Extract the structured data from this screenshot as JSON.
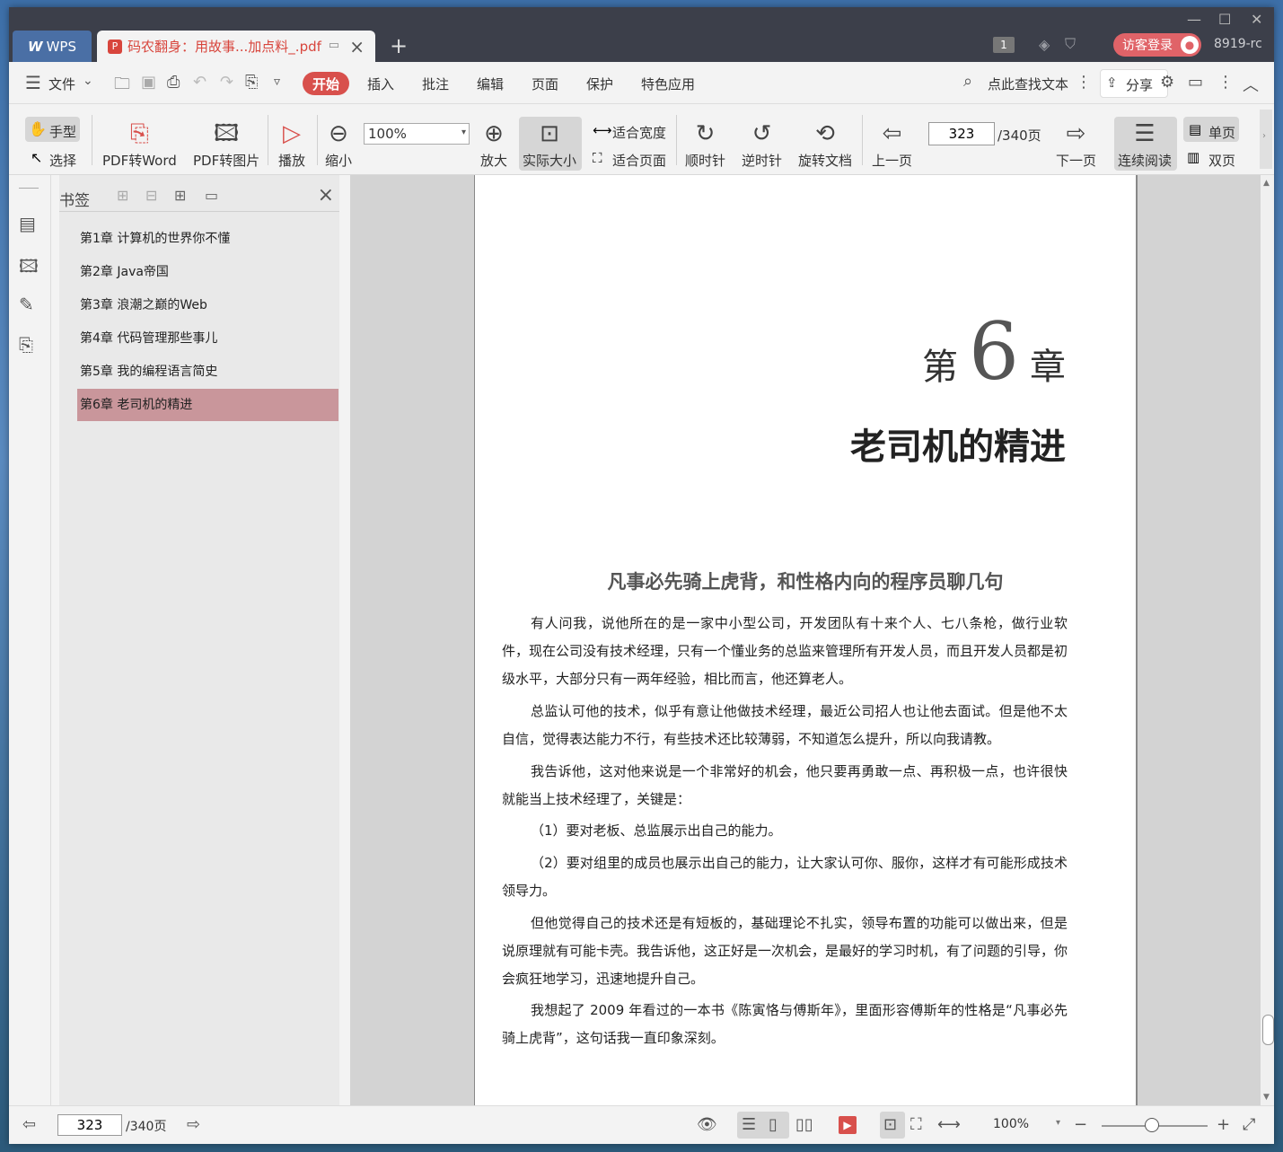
{
  "titlebar": {
    "wps_tab": "WPS",
    "doc_tab": "码农翻身：用故事...加点料_.pdf",
    "new_tab": "+",
    "badge": "1",
    "login": "访客登录",
    "user": "8919-rc"
  },
  "menu": {
    "file": "文件",
    "start": "开始",
    "insert": "插入",
    "annotate": "批注",
    "edit": "编辑",
    "page": "页面",
    "protect": "保护",
    "special": "特色应用",
    "search": "点此查找文本",
    "share": "分享"
  },
  "toolbar": {
    "hand": "手型",
    "select": "选择",
    "pdf_word": "PDF转Word",
    "pdf_img": "PDF转图片",
    "play": "播放",
    "zoom_out": "缩小",
    "zoom_value": "100%",
    "zoom_in": "放大",
    "actual": "实际大小",
    "fit_width": "适合宽度",
    "fit_page": "适合页面",
    "cw": "顺时针",
    "ccw": "逆时针",
    "rotate": "旋转文档",
    "prev": "上一页",
    "page_current": "323",
    "page_total": "/340页",
    "next": "下一页",
    "continuous": "连续阅读",
    "single": "单页",
    "double": "双页"
  },
  "bookmarks": {
    "title": "书签",
    "items": [
      "第1章 计算机的世界你不懂",
      "第2章 Java帝国",
      "第3章 浪潮之巅的Web",
      "第4章 代码管理那些事儿",
      "第5章 我的编程语言简史",
      "第6章 老司机的精进"
    ]
  },
  "page": {
    "chapter_pre": "第",
    "chapter_num": "6",
    "chapter_post": "章",
    "chapter_title": "老司机的精进",
    "section_title": "凡事必先骑上虎背，和性格内向的程序员聊几句",
    "paragraphs": [
      "有人问我，说他所在的是一家中小型公司，开发团队有十来个人、七八条枪，做行业软件，现在公司没有技术经理，只有一个懂业务的总监来管理所有开发人员，而且开发人员都是初级水平，大部分只有一两年经验，相比而言，他还算老人。",
      "总监认可他的技术，似乎有意让他做技术经理，最近公司招人也让他去面试。但是他不太自信，觉得表达能力不行，有些技术还比较薄弱，不知道怎么提升，所以向我请教。",
      "我告诉他，这对他来说是一个非常好的机会，他只要再勇敢一点、再积极一点，也许很快就能当上技术经理了，关键是：",
      "（1）要对老板、总监展示出自己的能力。",
      "（2）要对组里的成员也展示出自己的能力，让大家认可你、服你，这样才有可能形成技术领导力。",
      "但他觉得自己的技术还是有短板的，基础理论不扎实，领导布置的功能可以做出来，但是说原理就有可能卡壳。我告诉他，这正好是一次机会，是最好的学习时机，有了问题的引导，你会疯狂地学习，迅速地提升自己。",
      "我想起了 2009 年看过的一本书《陈寅恪与傅斯年》，里面形容傅斯年的性格是“凡事必先骑上虎背”，这句话我一直印象深刻。"
    ]
  },
  "status": {
    "page_current": "323",
    "page_total": "/340页",
    "zoom": "100%"
  },
  "colors": {
    "accent": "#d8504c",
    "titlebar": "#3c3f4a",
    "bookmark_active": "#c9969b"
  }
}
